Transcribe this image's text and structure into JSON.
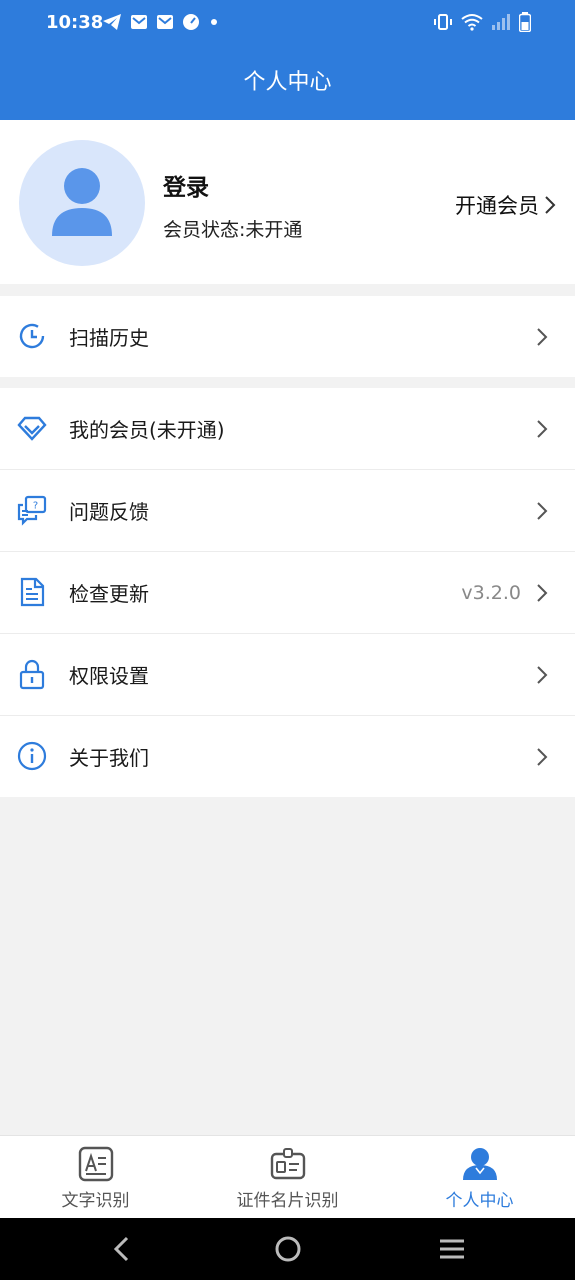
{
  "status_bar": {
    "time": "10:38"
  },
  "header": {
    "title": "个人中心"
  },
  "profile": {
    "login_label": "登录",
    "member_status": "会员状态:未开通",
    "open_member_label": "开通会员"
  },
  "menu_group_1": [
    {
      "label": "扫描历史",
      "icon": "history-clock-icon"
    }
  ],
  "menu_group_2": [
    {
      "label": "我的会员(未开通)",
      "icon": "diamond-icon"
    },
    {
      "label": "问题反馈",
      "icon": "feedback-icon"
    },
    {
      "label": "检查更新",
      "icon": "document-icon",
      "value": "v3.2.0"
    },
    {
      "label": "权限设置",
      "icon": "lock-icon"
    },
    {
      "label": "关于我们",
      "icon": "info-icon"
    }
  ],
  "tabs": [
    {
      "label": "文字识别",
      "icon": "text-recognition-icon",
      "active": false
    },
    {
      "label": "证件名片识别",
      "icon": "id-card-icon",
      "active": false
    },
    {
      "label": "个人中心",
      "icon": "person-icon",
      "active": true
    }
  ],
  "colors": {
    "accent": "#2e7cdc",
    "avatar_bg": "#d9e6fb",
    "avatar_fg": "#5a96ea"
  }
}
